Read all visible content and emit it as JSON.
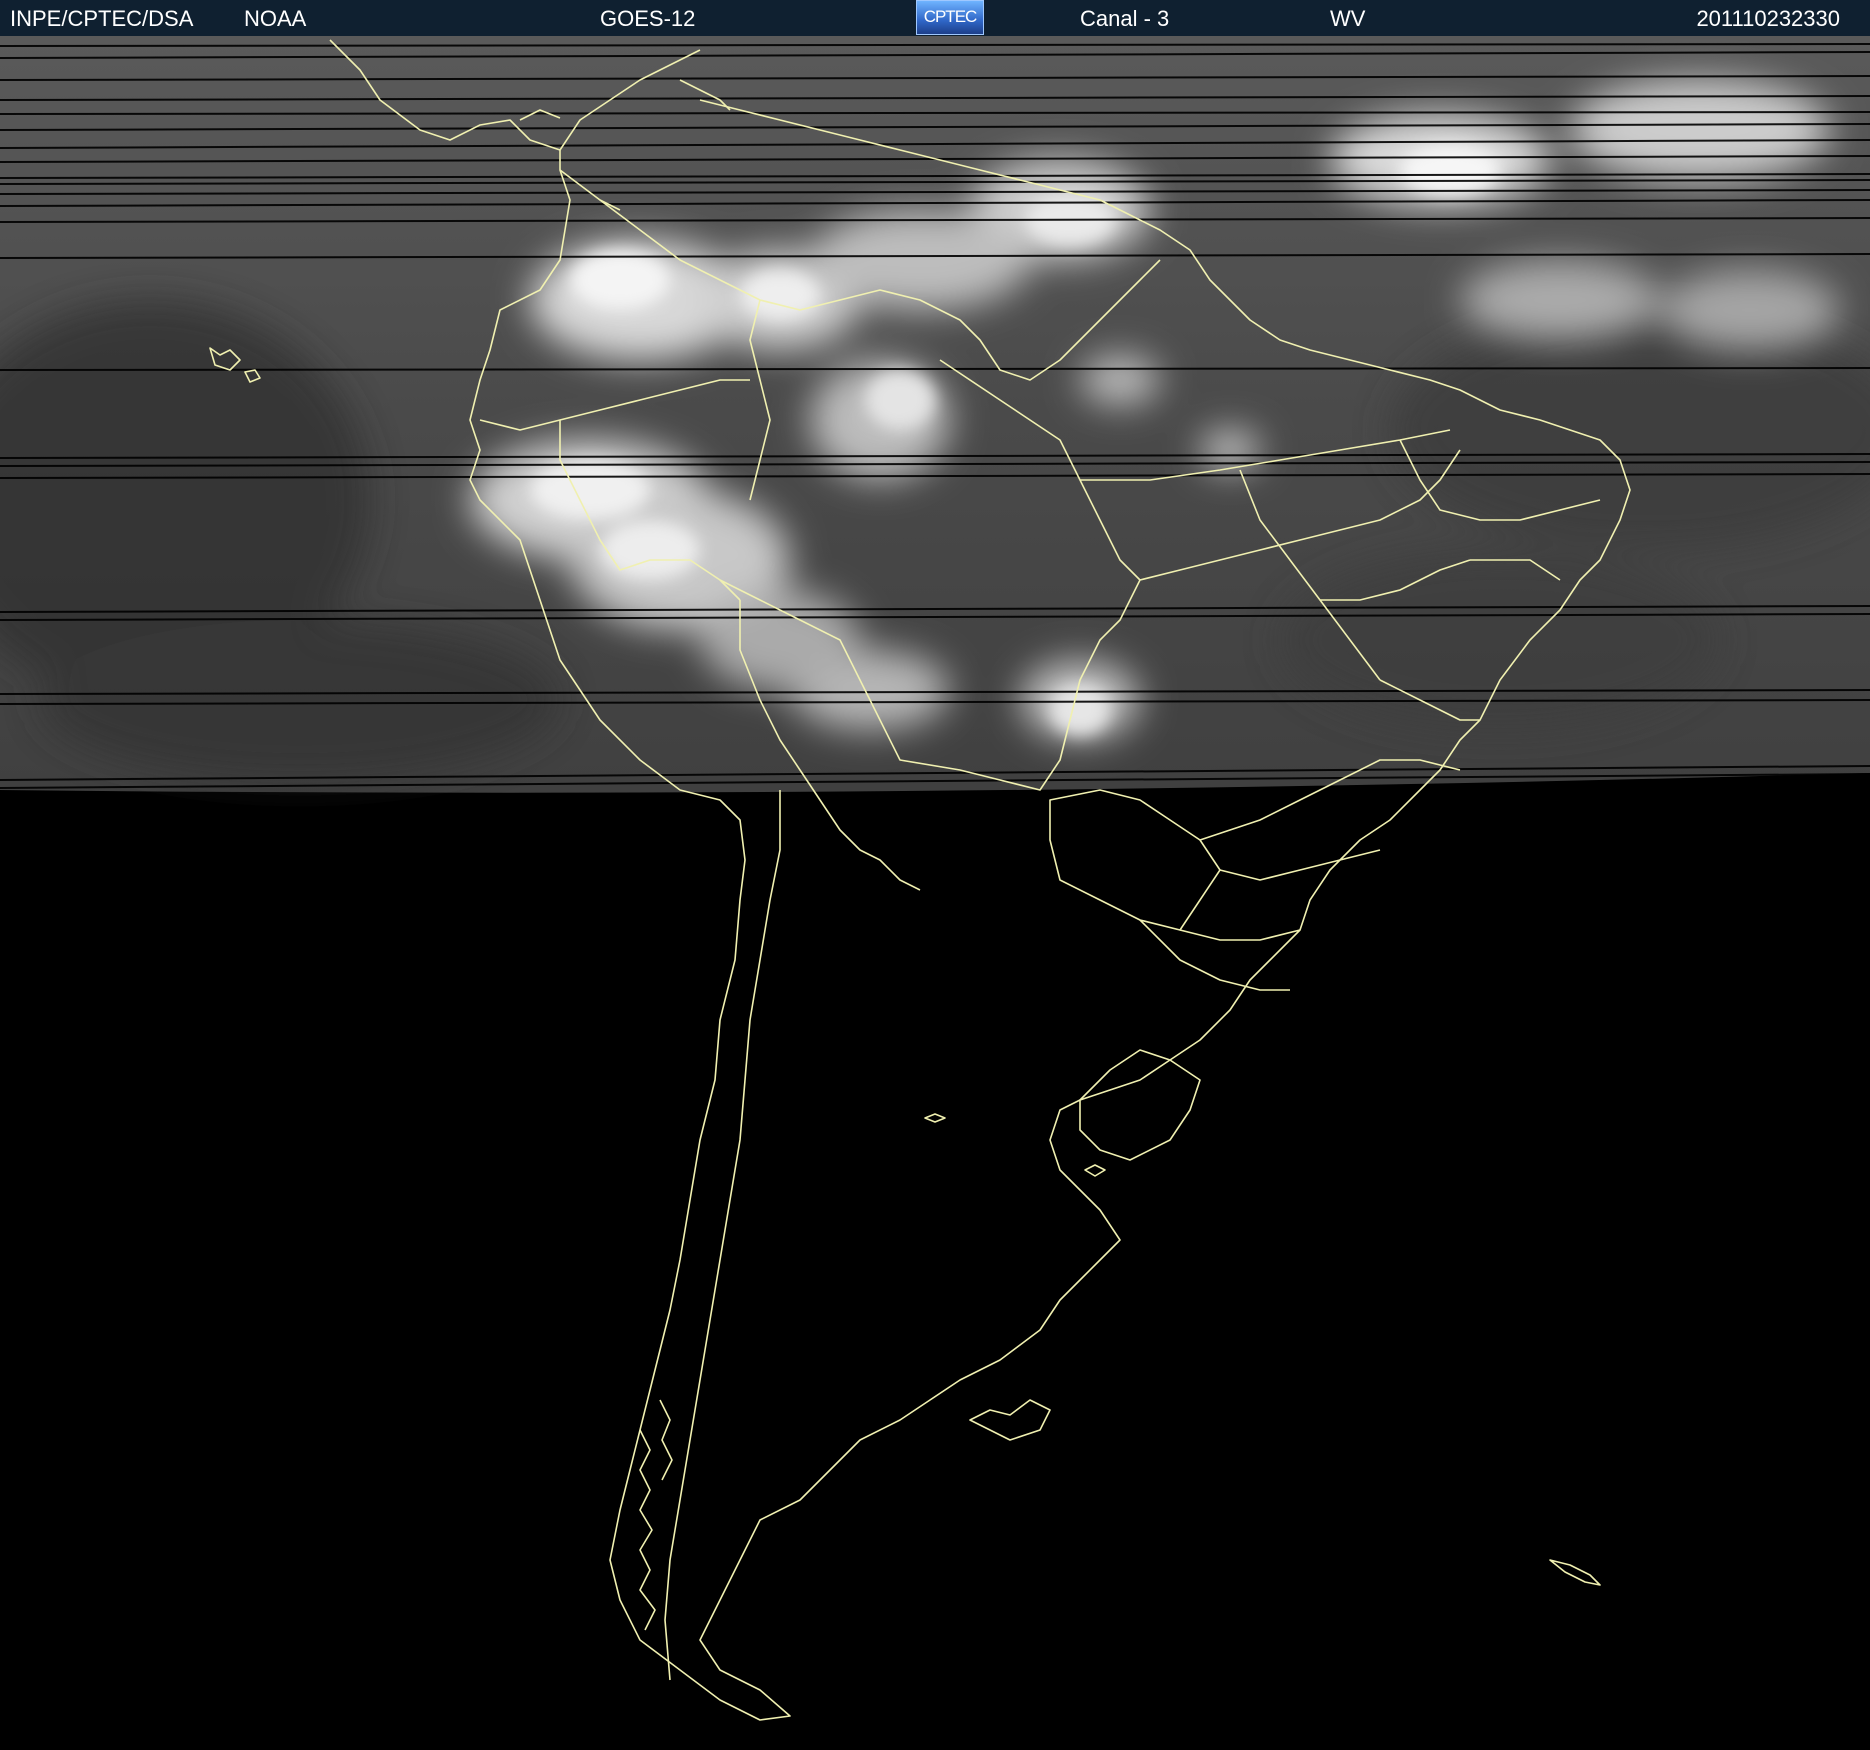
{
  "header": {
    "institution": "INPE/CPTEC/DSA",
    "agency": "NOAA",
    "satellite": "GOES-12",
    "logo_text": "CPTEC",
    "channel": "Canal - 3",
    "band": "WV",
    "timestamp": "201110232330"
  },
  "colors": {
    "header_bg": "#0f2030",
    "header_text": "#ffffff",
    "coastline": "#f0f0b0",
    "background": "#000000",
    "imagery_base": "#4a4a4a"
  },
  "map": {
    "icon": "satellite-imagery",
    "region": "South America"
  }
}
